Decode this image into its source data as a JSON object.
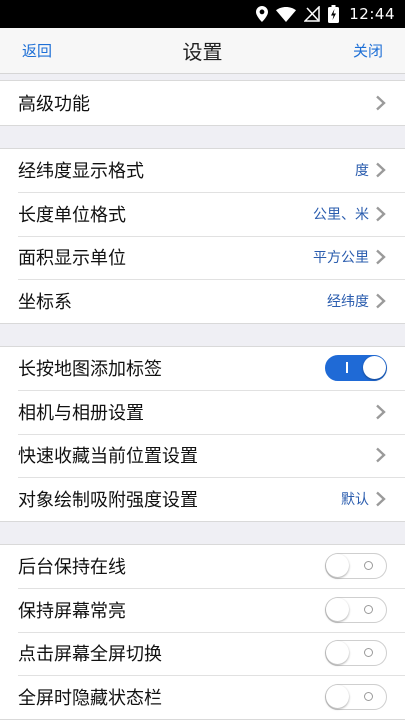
{
  "statusbar": {
    "time": "12:44"
  },
  "navbar": {
    "back": "返回",
    "title": "设置",
    "close": "关闭"
  },
  "groups": {
    "advanced": {
      "items": [
        {
          "label": "高级功能"
        }
      ]
    },
    "units": {
      "items": [
        {
          "label": "经纬度显示格式",
          "value": "度"
        },
        {
          "label": "长度单位格式",
          "value": "公里、米"
        },
        {
          "label": "面积显示单位",
          "value": "平方公里"
        },
        {
          "label": "坐标系",
          "value": "经纬度"
        }
      ]
    },
    "map": {
      "items": [
        {
          "label": "长按地图添加标签",
          "toggle": "on"
        },
        {
          "label": "相机与相册设置"
        },
        {
          "label": "快速收藏当前位置设置"
        },
        {
          "label": "对象绘制吸附强度设置",
          "value": "默认"
        }
      ]
    },
    "display": {
      "items": [
        {
          "label": "后台保持在线",
          "toggle": "off"
        },
        {
          "label": "保持屏幕常亮",
          "toggle": "off"
        },
        {
          "label": "点击屏幕全屏切换",
          "toggle": "off"
        },
        {
          "label": "全屏时隐藏状态栏",
          "toggle": "off"
        }
      ]
    }
  },
  "colors": {
    "accent": "#1d6fd6",
    "value_text": "#2a5cae",
    "toggle_on": "#1f6ad6"
  }
}
